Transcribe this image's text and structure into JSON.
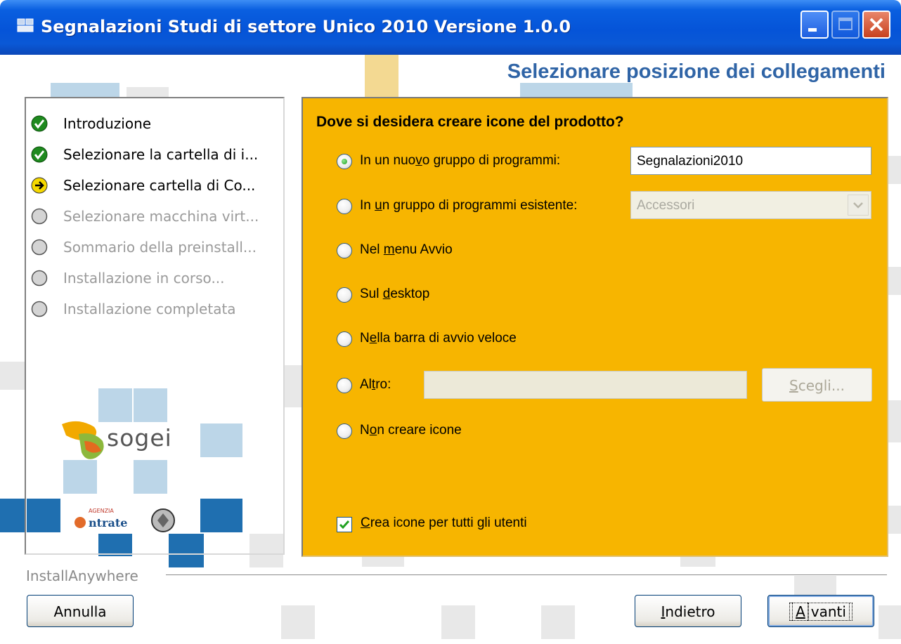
{
  "window": {
    "title": "Segnalazioni Studi di settore Unico 2010 Versione 1.0.0",
    "controls": [
      "minimize-button",
      "maximize-button",
      "close-button"
    ]
  },
  "page": {
    "heading": "Selezionare posizione dei collegamenti"
  },
  "steps": [
    {
      "label": "Introduzione",
      "status": "done"
    },
    {
      "label": "Selezionare la cartella di i...",
      "status": "done"
    },
    {
      "label": "Selezionare cartella di Co...",
      "status": "current"
    },
    {
      "label": "Selezionare macchina virt...",
      "status": "pending"
    },
    {
      "label": "Sommario della preinstall...",
      "status": "pending"
    },
    {
      "label": "Installazione in corso...",
      "status": "pending"
    },
    {
      "label": "Installazione completata",
      "status": "pending"
    }
  ],
  "logos": {
    "sogei": "sogei",
    "entrate_icon": "agenzia-entrate-logo"
  },
  "form": {
    "question": "Dove si desidera creare icone del prodotto?",
    "options": {
      "nuovo_gruppo": {
        "pre": "In un nuo",
        "u": "v",
        "post": "o gruppo di programmi:",
        "selected": true
      },
      "gruppo_esistente": {
        "pre": "In ",
        "u": "u",
        "post": "n gruppo di programmi esistente:",
        "selected": false
      },
      "menu_avvio": {
        "pre": "Nel ",
        "u": "m",
        "post": "enu Avvio",
        "selected": false
      },
      "desktop": {
        "pre": "Sul ",
        "u": "d",
        "post": "esktop",
        "selected": false
      },
      "barra_avvio": {
        "pre": "N",
        "u": "e",
        "post": "lla barra di avvio veloce",
        "selected": false
      },
      "altro": {
        "pre": "Al",
        "u": "t",
        "post": "ro:",
        "selected": false
      },
      "non_creare": {
        "pre": "N",
        "u": "o",
        "post": "n creare icone",
        "selected": false
      }
    },
    "group_name_value": "Segnalazioni2010",
    "existing_group_value": "Accessori",
    "altro_value": "",
    "scegli_button": {
      "u": "S",
      "post": "cegli..."
    },
    "all_users_checkbox": {
      "u": "C",
      "post": "rea icone per tutti gli utenti",
      "checked": true
    }
  },
  "footer": {
    "brand": "InstallAnywhere",
    "annulla": "Annulla",
    "indietro": {
      "u": "I",
      "post": "ndietro"
    },
    "avanti": {
      "u": "A",
      "post": "vanti"
    }
  },
  "colors": {
    "panel": "#f7b500",
    "titlebar": "#0554d8",
    "heading": "#2f64a6"
  }
}
